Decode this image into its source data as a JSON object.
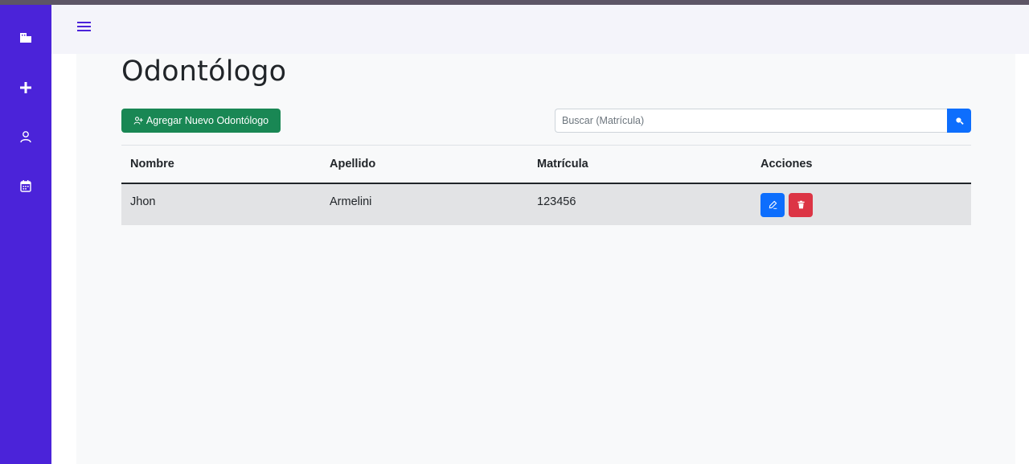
{
  "colors": {
    "sidebar": "#4b23d9",
    "success": "#198754",
    "primary": "#0d6efd",
    "danger": "#dc3545"
  },
  "sidebar": {
    "items": [
      {
        "icon": "building-icon"
      },
      {
        "icon": "plus-icon"
      },
      {
        "icon": "user-icon"
      },
      {
        "icon": "calendar-icon"
      }
    ]
  },
  "topbar": {
    "menu_icon": "hamburger-icon"
  },
  "page": {
    "title": "Odontólogo",
    "add_button_label": "Agregar Nuevo Odontólogo",
    "add_button_icon": "user-plus-icon",
    "search_placeholder": "Buscar (Matrícula)",
    "search_icon": "search-icon"
  },
  "table": {
    "headers": [
      "Nombre",
      "Apellido",
      "Matrícula",
      "Acciones"
    ],
    "rows": [
      {
        "nombre": "Jhon",
        "apellido": "Armelini",
        "matricula": "123456",
        "actions": [
          "edit-icon",
          "trash-icon"
        ]
      }
    ]
  }
}
